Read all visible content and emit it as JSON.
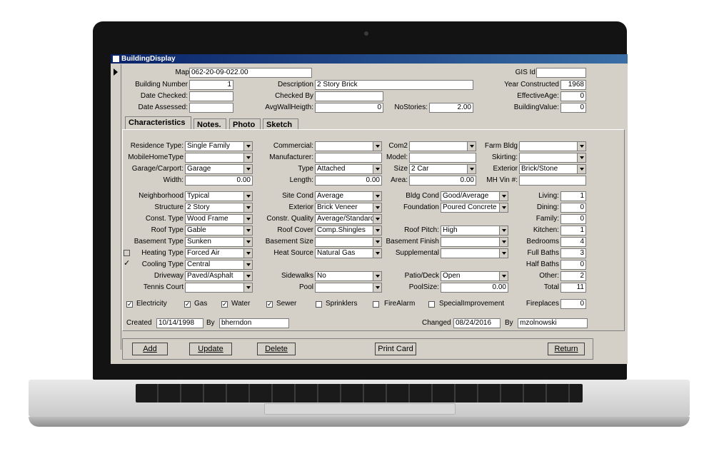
{
  "window": {
    "title": "BuildingDisplay"
  },
  "header": {
    "map": {
      "label": "Map",
      "value": "062-20-09-022.00"
    },
    "gis_id": {
      "label": "GIS Id",
      "value": ""
    },
    "building_number": {
      "label": "Building Number",
      "value": "1"
    },
    "description": {
      "label": "Description",
      "value": "2 Story Brick"
    },
    "year_constructed": {
      "label": "Year Constructed",
      "value": "1968"
    },
    "date_checked": {
      "label": "Date Checked:",
      "value": ""
    },
    "checked_by": {
      "label": "Checked By",
      "value": ""
    },
    "effective_age": {
      "label": "EffectiveAge:",
      "value": "0"
    },
    "date_assessed": {
      "label": "Date Assessed:",
      "value": ""
    },
    "avg_wall_height": {
      "label": "AvgWallHeigth:",
      "value": "0"
    },
    "no_stories": {
      "label": "NoStories:",
      "value": "2.00"
    },
    "building_value": {
      "label": "BuildingValue:",
      "value": "0"
    }
  },
  "tabs": [
    {
      "label": "Characteristics"
    },
    {
      "label": "Notes."
    },
    {
      "label": "Photo"
    },
    {
      "label": "Sketch"
    }
  ],
  "section1": {
    "residence_type": {
      "label": "Residence Type:",
      "value": "Single Family"
    },
    "commercial": {
      "label": "Commercial:",
      "value": ""
    },
    "com2": {
      "label": "Com2",
      "value": ""
    },
    "farm_bldg": {
      "label": "Farm Bldg",
      "value": ""
    },
    "mobile_home_type": {
      "label": "MobileHomeType",
      "value": ""
    },
    "manufacturer": {
      "label": "Manufacturer:",
      "value": ""
    },
    "model": {
      "label": "Model:",
      "value": ""
    },
    "skirting": {
      "label": "Skirting:",
      "value": ""
    },
    "garage_carport": {
      "label": "Garage/Carport:",
      "value": "Garage"
    },
    "type": {
      "label": "Type",
      "value": "Attached"
    },
    "size": {
      "label": "Size",
      "value": "2 Car"
    },
    "exterior": {
      "label": "Exterior",
      "value": "Brick/Stone"
    },
    "width": {
      "label": "Width:",
      "value": "0.00"
    },
    "length": {
      "label": "Length:",
      "value": "0.00"
    },
    "area": {
      "label": "Area:",
      "value": "0.00"
    },
    "mh_vin": {
      "label": "MH Vin #:",
      "value": ""
    }
  },
  "section2": {
    "neighborhood": {
      "label": "Neighborhood",
      "value": "Typical"
    },
    "site_cond": {
      "label": "Site Cond",
      "value": "Average"
    },
    "bldg_cond": {
      "label": "Bldg Cond",
      "value": "Good/Average"
    },
    "living": {
      "label": "Living:",
      "value": "1"
    },
    "structure": {
      "label": "Structure",
      "value": "2 Story"
    },
    "exterior2": {
      "label": "Exterior",
      "value": "Brick Veneer"
    },
    "foundation": {
      "label": "Foundation",
      "value": "Poured Concrete"
    },
    "dining": {
      "label": "Dining:",
      "value": "0"
    },
    "const_type": {
      "label": "Const. Type",
      "value": "Wood Frame"
    },
    "constr_quality": {
      "label": "Constr. Quality",
      "value": "Average/Standard"
    },
    "family": {
      "label": "Family:",
      "value": "0"
    },
    "roof_type": {
      "label": "Roof Type",
      "value": "Gable"
    },
    "roof_cover": {
      "label": "Roof Cover",
      "value": "Comp.Shingles"
    },
    "roof_pitch": {
      "label": "Roof Pitch:",
      "value": "High"
    },
    "kitchen": {
      "label": "Kitchen:",
      "value": "1"
    },
    "basement_type": {
      "label": "Basement Type",
      "value": "Sunken"
    },
    "basement_size": {
      "label": "Basement Size",
      "value": ""
    },
    "basement_finish": {
      "label": "Basement Finish",
      "value": ""
    },
    "bedrooms": {
      "label": "Bedrooms",
      "value": "4"
    },
    "heating_type": {
      "label": "Heating Type",
      "value": "Forced Air"
    },
    "heat_source": {
      "label": "Heat Source",
      "value": "Natural Gas"
    },
    "supplemental": {
      "label": "Supplemental",
      "value": ""
    },
    "full_baths": {
      "label": "Full Baths",
      "value": "3"
    },
    "cooling_type": {
      "label": "Cooling Type",
      "value": "Central"
    },
    "half_baths": {
      "label": "Half Baths",
      "value": "0"
    },
    "driveway": {
      "label": "Driveway",
      "value": "Paved/Asphalt"
    },
    "sidewalks": {
      "label": "Sidewalks",
      "value": "No"
    },
    "patio_deck": {
      "label": "Patio/Deck",
      "value": "Open"
    },
    "other": {
      "label": "Other:",
      "value": "2"
    },
    "tennis_court": {
      "label": "Tennis Court",
      "value": ""
    },
    "pool": {
      "label": "Pool",
      "value": ""
    },
    "pool_size": {
      "label": "PoolSize:",
      "value": "0.00"
    },
    "total": {
      "label": "Total",
      "value": "11"
    }
  },
  "utilities": {
    "electricity": {
      "label": "Electricity",
      "checked": true
    },
    "gas": {
      "label": "Gas",
      "checked": true
    },
    "water": {
      "label": "Water",
      "checked": true
    },
    "sewer": {
      "label": "Sewer",
      "checked": true
    },
    "sprinklers": {
      "label": "Sprinklers",
      "checked": false
    },
    "fire_alarm": {
      "label": "FireAlarm",
      "checked": false
    },
    "special_improvement": {
      "label": "SpecialImprovement",
      "checked": false
    },
    "fireplaces": {
      "label": "Fireplaces",
      "value": "0"
    }
  },
  "audit": {
    "created_label": "Created",
    "created_value": "10/14/1998",
    "by_label": "By",
    "created_by": "bherndon",
    "changed_label": "Changed",
    "changed_value": "08/24/2016",
    "changed_by": "mzolnowski"
  },
  "buttons": {
    "add": "Add",
    "update": "Update",
    "delete": "Delete",
    "print_card": "Print Card",
    "return": "Return"
  }
}
